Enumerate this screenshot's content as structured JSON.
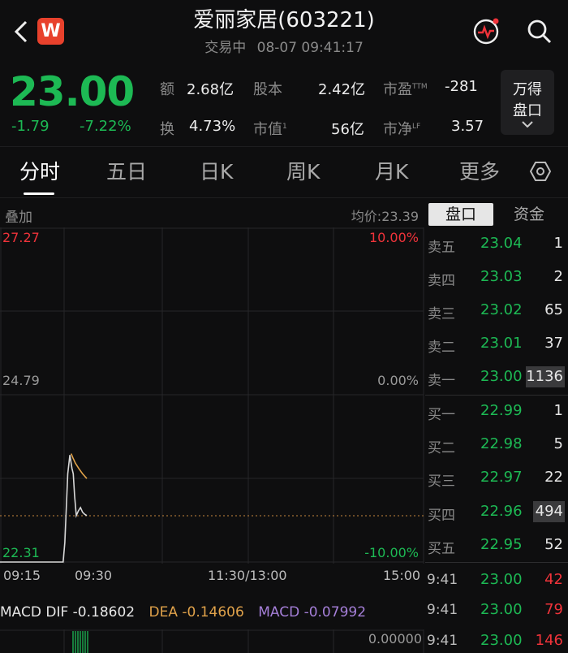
{
  "header": {
    "back_icon": "chevron-left-icon",
    "app_badge": "W",
    "title": "爱丽家居(603221)",
    "status": "交易中",
    "datetime": "08-07 09:41:17",
    "pulse_icon": "pulse-icon",
    "search_icon": "search-icon"
  },
  "quote": {
    "price": "23.00",
    "change": "-1.79",
    "change_pct": "-7.22%",
    "stats": [
      {
        "label": "额",
        "value": "2.68亿"
      },
      {
        "label": "股本",
        "value": "2.42亿"
      },
      {
        "label": "市盈",
        "sup": "TTM",
        "value": "-281"
      },
      {
        "label": "换",
        "value": "4.73%"
      },
      {
        "label": "市值",
        "sup": "1",
        "value": "56亿"
      },
      {
        "label": "市净",
        "sup": "LF",
        "value": "3.57"
      }
    ],
    "depth_button_line1": "万得",
    "depth_button_line2": "盘口"
  },
  "tabs": [
    "分时",
    "五日",
    "日K",
    "周K",
    "月K",
    "更多"
  ],
  "settings_icon": "hexagon-settings-icon",
  "chart_header": {
    "overlay": "叠加",
    "avg_price": "均价:23.39",
    "tab_orderbook": "盘口",
    "tab_funds": "资金"
  },
  "chart_data": {
    "type": "line",
    "y_labels": {
      "top": "27.27",
      "mid": "24.79",
      "bottom": "22.31"
    },
    "pct_labels": {
      "top": "10.00%",
      "mid": "0.00%",
      "bottom": "-10.00%"
    },
    "x_labels": [
      "09:15",
      "09:30",
      "11:30/13:00",
      "15:00"
    ],
    "ylim": [
      22.31,
      27.27
    ],
    "series": [
      {
        "color": "#d8d8d8",
        "points": [
          [
            0,
            22.31
          ],
          [
            0.149,
            22.31
          ],
          [
            0.153,
            22.6
          ],
          [
            0.16,
            23.62
          ],
          [
            0.165,
            23.9
          ],
          [
            0.17,
            23.7
          ],
          [
            0.173,
            23.62
          ],
          [
            0.176,
            23.3
          ],
          [
            0.18,
            23.0
          ],
          [
            0.185,
            23.07
          ],
          [
            0.19,
            23.12
          ],
          [
            0.195,
            23.05
          ],
          [
            0.2,
            23.02
          ],
          [
            0.205,
            23.0
          ]
        ]
      },
      {
        "color": "#e0a24a",
        "points": [
          [
            0.168,
            23.92
          ],
          [
            0.172,
            23.86
          ],
          [
            0.178,
            23.78
          ],
          [
            0.186,
            23.7
          ],
          [
            0.195,
            23.62
          ],
          [
            0.205,
            23.55
          ]
        ]
      }
    ]
  },
  "orderbook": {
    "asks": [
      {
        "label": "卖五",
        "price": "23.04",
        "vol": "1"
      },
      {
        "label": "卖四",
        "price": "23.03",
        "vol": "2"
      },
      {
        "label": "卖三",
        "price": "23.02",
        "vol": "65"
      },
      {
        "label": "卖二",
        "price": "23.01",
        "vol": "37"
      },
      {
        "label": "卖一",
        "price": "23.00",
        "vol": "1136"
      }
    ],
    "bids": [
      {
        "label": "买一",
        "price": "22.99",
        "vol": "1"
      },
      {
        "label": "买二",
        "price": "22.98",
        "vol": "5"
      },
      {
        "label": "买三",
        "price": "22.97",
        "vol": "22"
      },
      {
        "label": "买四",
        "price": "22.96",
        "vol": "494"
      },
      {
        "label": "买五",
        "price": "22.95",
        "vol": "52"
      }
    ]
  },
  "ticks": [
    {
      "time": "9:41",
      "price": "23.00",
      "vol": "42"
    },
    {
      "time": "9:41",
      "price": "23.00",
      "vol": "79"
    },
    {
      "time": "9:41",
      "price": "23.00",
      "vol": "146"
    }
  ],
  "macd": {
    "dif_label": "MACD DIF -0.18602",
    "dea_label": "DEA -0.14606",
    "macd_label": "MACD -0.07992",
    "axis_value": "0.00000"
  }
}
